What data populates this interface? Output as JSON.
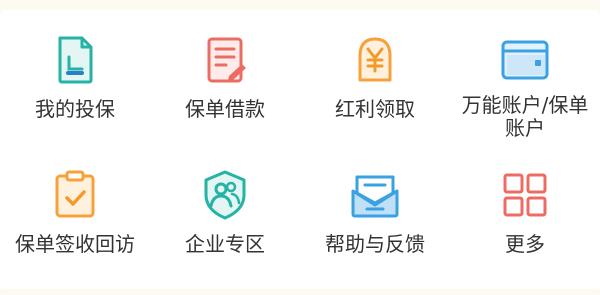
{
  "menu": {
    "items": [
      {
        "label": "我的投保",
        "icon": "policy-document-icon"
      },
      {
        "label": "保单借款",
        "icon": "policy-loan-icon"
      },
      {
        "label": "红利领取",
        "icon": "dividend-yen-icon"
      },
      {
        "label": "万能账户/保单账户",
        "icon": "wallet-icon"
      },
      {
        "label": "保单签收回访",
        "icon": "clipboard-check-icon"
      },
      {
        "label": "企业专区",
        "icon": "enterprise-badge-icon"
      },
      {
        "label": "帮助与反馈",
        "icon": "inbox-tray-icon"
      },
      {
        "label": "更多",
        "icon": "more-grid-icon"
      }
    ]
  },
  "colors": {
    "teal": "#25b3a6",
    "coral": "#ee6b62",
    "orange": "#f6a13a",
    "blue": "#3aa2e3",
    "text": "#333333",
    "background": "#fdfaf2"
  }
}
